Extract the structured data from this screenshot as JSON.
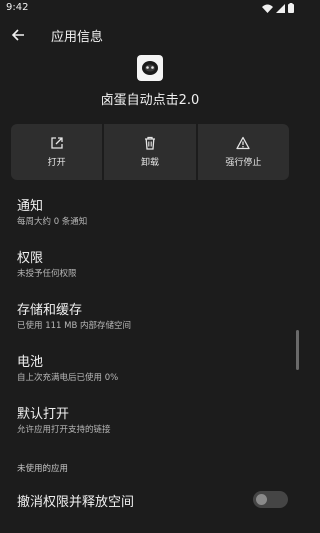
{
  "status_bar": {
    "time": "9:42"
  },
  "app_bar": {
    "title": "应用信息"
  },
  "app": {
    "name": "卤蛋自动点击2.0"
  },
  "actions": [
    {
      "label": "打开",
      "icon": "open-external-icon"
    },
    {
      "label": "卸载",
      "icon": "trash-icon"
    },
    {
      "label": "强行停止",
      "icon": "warning-icon"
    }
  ],
  "items": [
    {
      "title": "通知",
      "subtitle": "每周大约 0 条通知"
    },
    {
      "title": "权限",
      "subtitle": "未授予任何权限"
    },
    {
      "title": "存储和缓存",
      "subtitle": "已使用 111 MB 内部存储空间"
    },
    {
      "title": "电池",
      "subtitle": "自上次充满电后已使用 0%"
    },
    {
      "title": "默认打开",
      "subtitle": "允许应用打开支持的链接"
    }
  ],
  "unused_section": {
    "header": "未使用的应用",
    "toggle_label": "撤消权限并释放空间",
    "toggle_on": false
  }
}
